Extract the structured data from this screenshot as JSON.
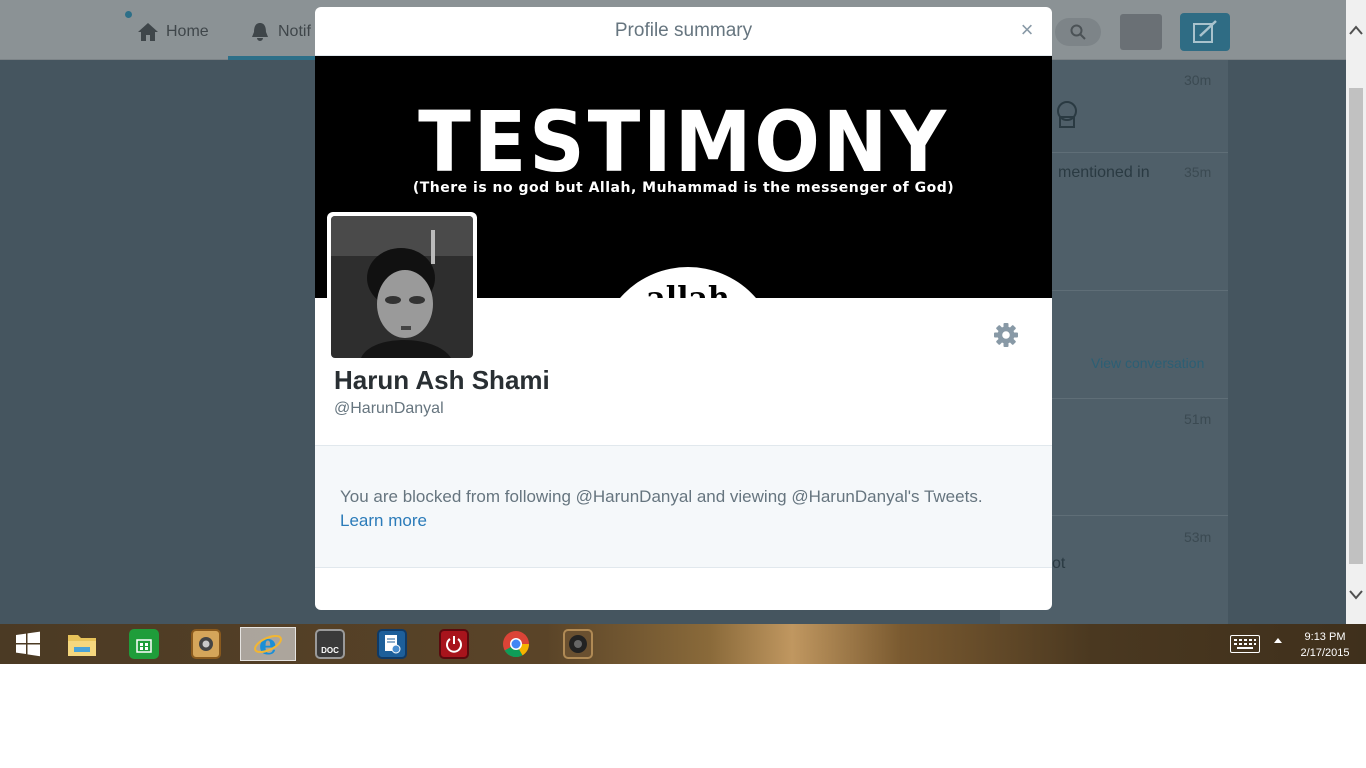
{
  "twitter_nav": {
    "home_label": "Home",
    "notifications_label": "Notif"
  },
  "background_stream": {
    "times": [
      "30m",
      "35m",
      "51m",
      "53m"
    ],
    "mentioned_text": "mentioned in",
    "view_conversation": "View conversation",
    "fragment_text": "ot"
  },
  "modal": {
    "title": "Profile summary",
    "close_label": "×",
    "banner_title": "TESTIMONY",
    "banner_subtitle": "(There is no god but Allah, Muhammad is the messenger of God)",
    "banner_circle_text": "allah"
  },
  "profile": {
    "name": "Harun Ash Shami",
    "handle": "@HarunDanyal"
  },
  "blocked": {
    "message": "You are blocked from following @HarunDanyal and viewing @HarunDanyal's Tweets.",
    "learn_more": "Learn more"
  },
  "taskbar": {
    "items": [
      {
        "name": "start-button",
        "icon": "windows-logo-icon"
      },
      {
        "name": "file-explorer",
        "icon": "folder-icon"
      },
      {
        "name": "store",
        "icon": "store-bag-icon"
      },
      {
        "name": "media-app",
        "icon": "camera-app-icon"
      },
      {
        "name": "internet-explorer",
        "icon": "ie-logo-icon",
        "active": true
      },
      {
        "name": "doc-app",
        "icon": "doc-icon"
      },
      {
        "name": "settings-app",
        "icon": "doc-gear-icon"
      },
      {
        "name": "power-app",
        "icon": "power-icon"
      },
      {
        "name": "chrome",
        "icon": "chrome-icon"
      },
      {
        "name": "speaker-app",
        "icon": "speaker-icon"
      }
    ],
    "doc_label": "DOC",
    "clock_time": "9:13 PM",
    "clock_date": "2/17/2015"
  }
}
